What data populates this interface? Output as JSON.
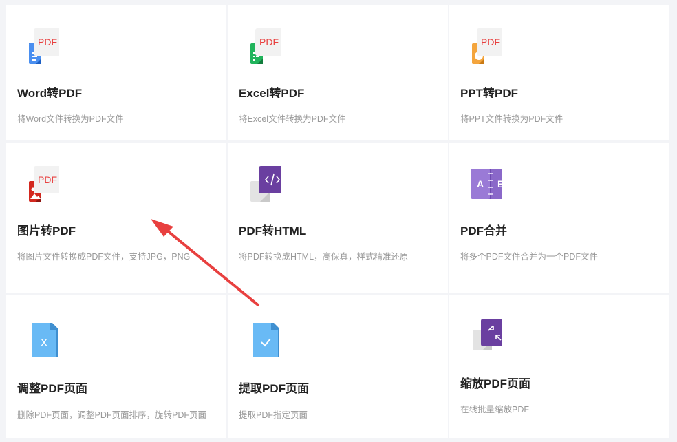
{
  "cards": [
    {
      "title": "Word转PDF",
      "desc": "将Word文件转换为PDF文件",
      "icon": "word-to-pdf-icon",
      "badge": "PDF"
    },
    {
      "title": "Excel转PDF",
      "desc": "将Excel文件转换为PDF文件",
      "icon": "excel-to-pdf-icon",
      "badge": "PDF"
    },
    {
      "title": "PPT转PDF",
      "desc": "将PPT文件转换为PDF文件",
      "icon": "ppt-to-pdf-icon",
      "badge": "PDF"
    },
    {
      "title": "图片转PDF",
      "desc": "将图片文件转换成PDF文件，支持JPG，PNG",
      "icon": "image-to-pdf-icon",
      "badge": "PDF"
    },
    {
      "title": "PDF转HTML",
      "desc": "将PDF转换成HTML，高保真，样式精准还原",
      "icon": "pdf-to-html-icon"
    },
    {
      "title": "PDF合并",
      "desc": "将多个PDF文件合并为一个PDF文件",
      "icon": "pdf-merge-icon",
      "letter_a": "A",
      "letter_b": "B"
    },
    {
      "title": "调整PDF页面",
      "desc": "删除PDF页面，调整PDF页面排序，旋转PDF页面",
      "icon": "adjust-pdf-pages-icon",
      "letter": "X"
    },
    {
      "title": "提取PDF页面",
      "desc": "提取PDF指定页面",
      "icon": "extract-pdf-pages-icon"
    },
    {
      "title": "缩放PDF页面",
      "desc": "在线批量缩放PDF",
      "icon": "scale-pdf-pages-icon"
    }
  ],
  "colors": {
    "annotation_arrow": "#e8403f",
    "word": "#4a8ff0",
    "excel": "#21b45c",
    "ppt": "#f4a53d",
    "image": "#d3281f",
    "purple": "#6a3fa0",
    "blue_doc": "#69baf5"
  }
}
